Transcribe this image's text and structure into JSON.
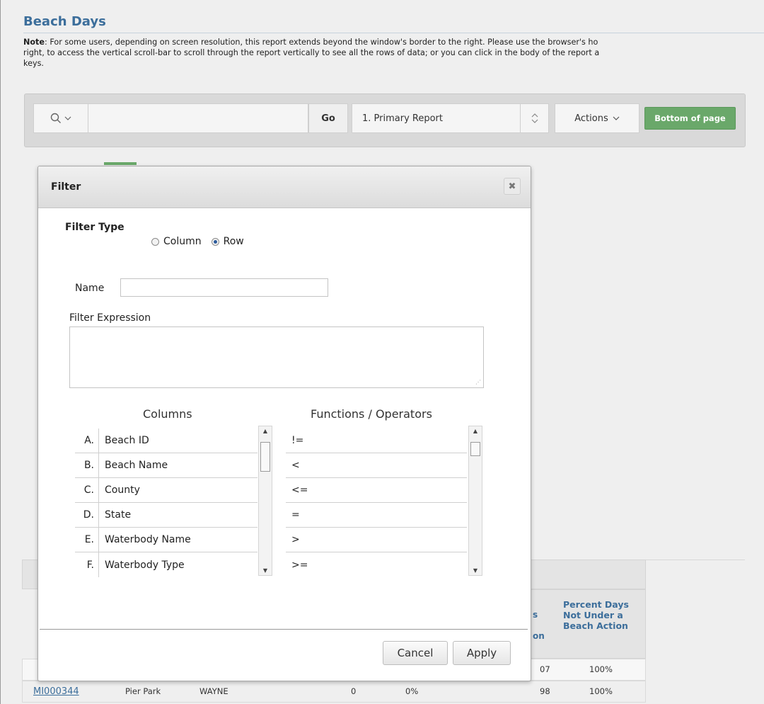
{
  "page": {
    "title": "Beach Days",
    "note_label": "Note",
    "note_lines": [
      ": For some users, depending on screen resolution, this report extends beyond the window's border to the right. Please use the browser's ho",
      "right, to access the vertical scroll-bar to scroll through the report vertically to see all the rows of data; or you can click in the body of the report a",
      "keys."
    ]
  },
  "toolbar": {
    "go_label": "Go",
    "report_select": "1. Primary Report",
    "actions_label": "Actions",
    "bottom_label": "Bottom of page"
  },
  "report": {
    "col_partial_lines": [
      "s",
      "on"
    ],
    "col_percent": "Percent Days Not Under a Beach Action",
    "row1": {
      "c7": "07",
      "c8": "100%"
    },
    "row2": {
      "id": "MI000344",
      "name": "Pier Park",
      "county": "WAYNE",
      "c5": "0",
      "c6": "0%",
      "c7": "98",
      "c8": "100%"
    }
  },
  "modal": {
    "title": "Filter",
    "close_glyph": "✖",
    "filter_type_label": "Filter Type",
    "radio_column": "Column",
    "radio_row": "Row",
    "name_label": "Name",
    "name_value": "",
    "expression_label": "Filter Expression",
    "expression_value": "",
    "columns_title": "Columns",
    "functions_title": "Functions / Operators",
    "columns": [
      {
        "letter": "A.",
        "name": "Beach ID"
      },
      {
        "letter": "B.",
        "name": "Beach Name"
      },
      {
        "letter": "C.",
        "name": "County"
      },
      {
        "letter": "D.",
        "name": "State"
      },
      {
        "letter": "E.",
        "name": "Waterbody Name"
      },
      {
        "letter": "F.",
        "name": "Waterbody Type"
      }
    ],
    "operators": [
      "!=",
      "<",
      "<=",
      "=",
      ">",
      ">="
    ],
    "cancel_label": "Cancel",
    "apply_label": "Apply"
  }
}
